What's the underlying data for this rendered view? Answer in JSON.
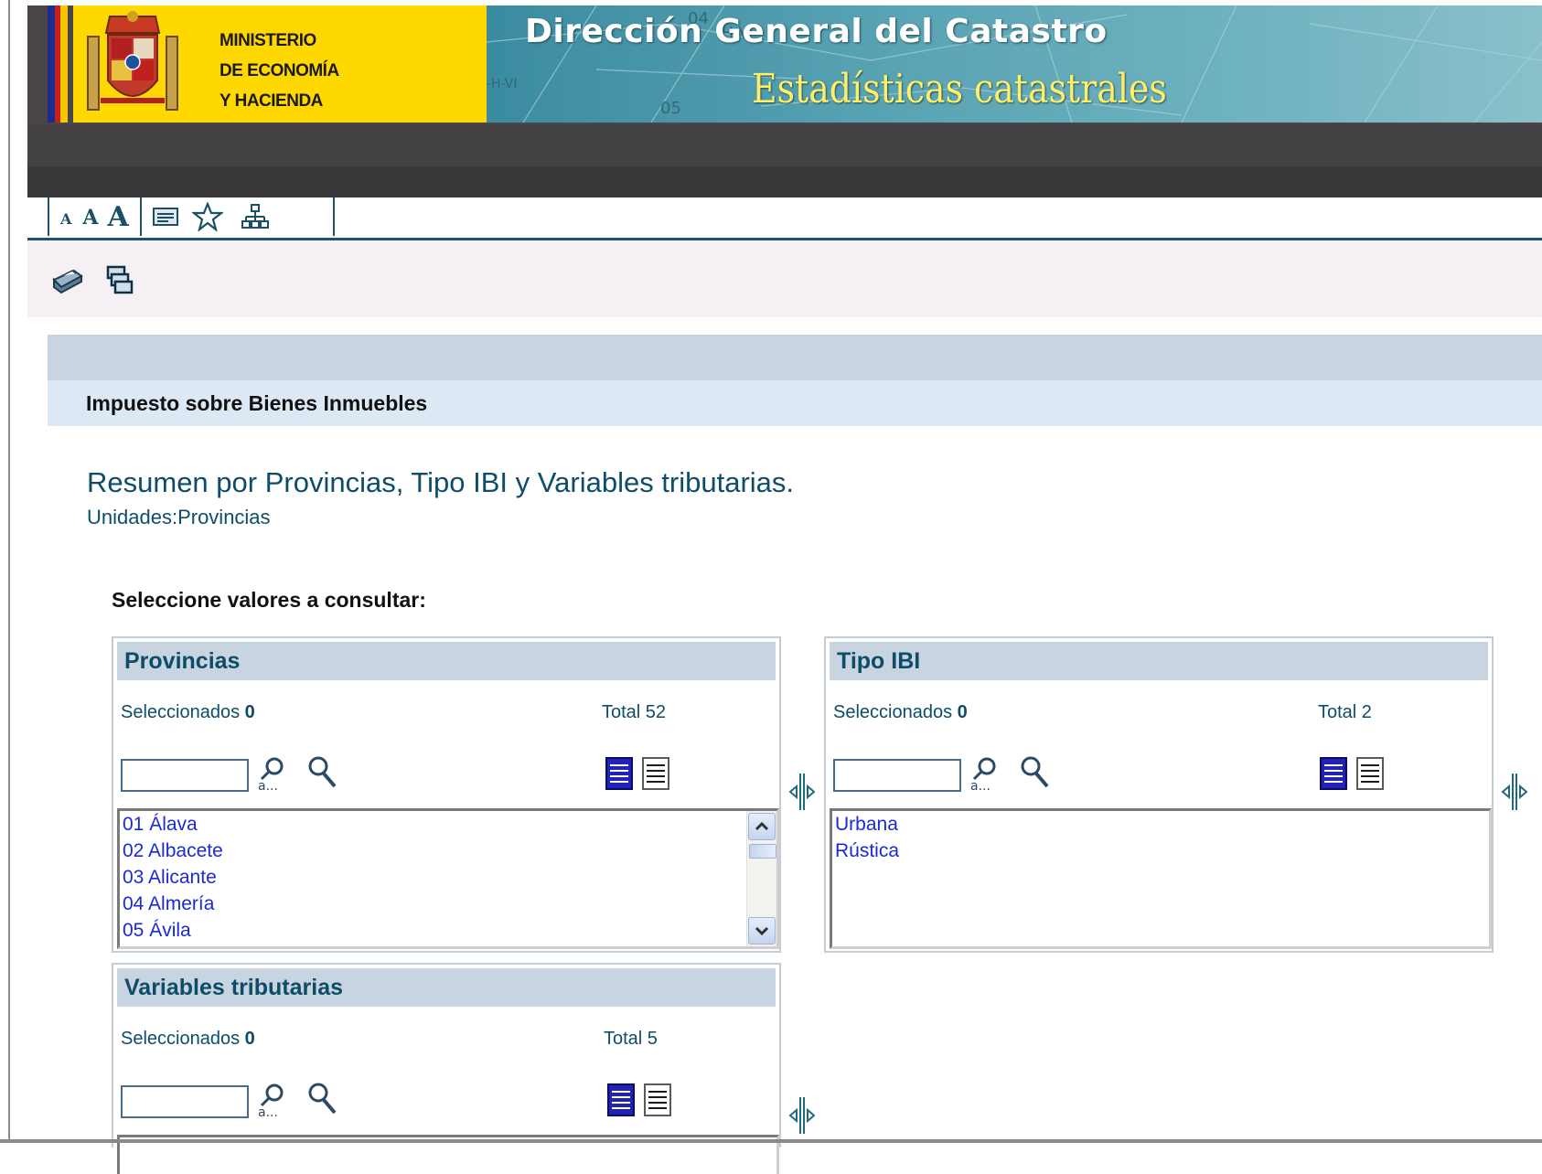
{
  "header": {
    "ministry_lines": [
      "MINISTERIO",
      "DE ECONOMÍA",
      "Y HACIENDA"
    ],
    "title": "Dirección General del Catastro",
    "subtitle": "Estadísticas catastrales"
  },
  "accessibility_toolbar": {
    "font_small": "A",
    "font_medium": "A",
    "font_large": "A",
    "icons": [
      "text-view-icon",
      "favorites-star-icon",
      "sitemap-icon"
    ]
  },
  "actions": {
    "icons": [
      "printer-icon",
      "copy-pages-icon"
    ]
  },
  "section": {
    "title": "Impuesto sobre Bienes Inmuebles"
  },
  "page": {
    "title": "Resumen por Provincias, Tipo IBI y Variables tributarias.",
    "subtitle": "Unidades:Provincias",
    "select_prompt": "Seleccione valores a consultar:"
  },
  "panels": {
    "provincias": {
      "title": "Provincias",
      "selected_label": "Seleccionados",
      "selected_count": "0",
      "total_label": "Total 52",
      "search_value": "",
      "items": [
        "01 Álava",
        "02 Albacete",
        "03 Alicante",
        "04 Almería",
        "05 Ávila"
      ]
    },
    "tipo_ibi": {
      "title": "Tipo IBI",
      "selected_label": "Seleccionados",
      "selected_count": "0",
      "total_label": "Total 2",
      "search_value": "",
      "items": [
        "Urbana",
        "Rústica"
      ]
    },
    "variables": {
      "title": "Variables tributarias",
      "selected_label": "Seleccionados",
      "selected_count": "0",
      "total_label": "Total 5",
      "search_value": ""
    }
  },
  "colors": {
    "accent": "#0d4d69",
    "list_link": "#1a2ad8",
    "panel_header": "#c8d4e0",
    "banner_yellow": "#ffd800"
  }
}
